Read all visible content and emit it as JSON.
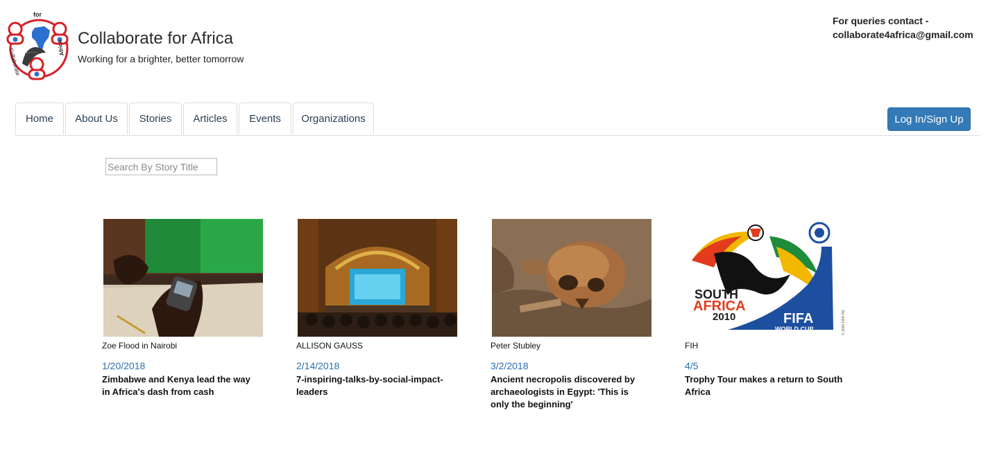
{
  "brand": {
    "title": "Collaborate for Africa",
    "tagline": "Working for a brighter, better tomorrow",
    "logo_text_top": "for",
    "logo_text_left": "Collaborate",
    "logo_text_right": "Africa"
  },
  "contact": {
    "line1": "For queries contact -",
    "line2": "collaborate4africa@gmail.com"
  },
  "nav": {
    "tabs": [
      {
        "label": "Home"
      },
      {
        "label": "About Us"
      },
      {
        "label": "Stories"
      },
      {
        "label": "Articles"
      },
      {
        "label": "Events"
      },
      {
        "label": "Organizations"
      }
    ],
    "login_label": "Log In/Sign Up"
  },
  "search": {
    "placeholder": "Search By Story Title",
    "value": ""
  },
  "stories": [
    {
      "author": "Zoe Flood in Nairobi",
      "date": "1/20/2018",
      "title": "Zimbabwe and Kenya lead the way in Africa's dash from cash",
      "image": "photo-mobile-phone"
    },
    {
      "author": "ALLISON GAUSS",
      "date": "2/14/2018",
      "title": "7-inspiring-talks-by-social-impact-leaders",
      "image": "photo-conference-hall"
    },
    {
      "author": "Peter Stubley",
      "date": "3/2/2018",
      "title": "Ancient necropolis discovered by archaeologists in Egypt: 'This is only the beginning'",
      "image": "photo-skull"
    },
    {
      "author": "FIH",
      "date": "4/5",
      "title": "Trophy Tour makes a return to South Africa",
      "image": "logo-world-cup",
      "logo_text": {
        "line1": "SOUTH",
        "line2": "AFRICA",
        "line3": "2010",
        "line4": "FIFA",
        "line5": "WORLD CUP",
        "fine_print": "© 2005 FIFA TM"
      }
    }
  ],
  "colors": {
    "accent": "#337ab7",
    "date": "#2a6fb0",
    "nav_text": "#2a3f55"
  }
}
